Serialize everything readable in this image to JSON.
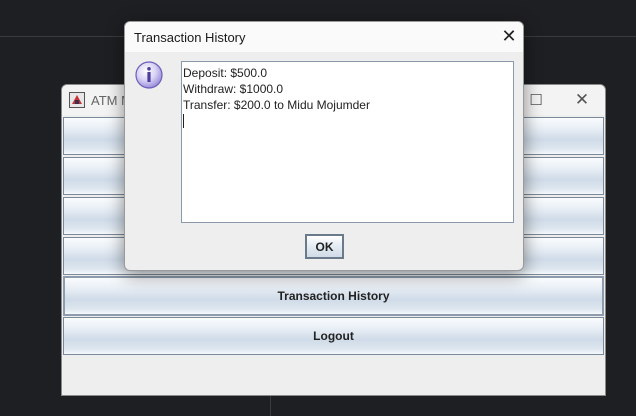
{
  "main_window": {
    "title": "ATM M",
    "buttons": [
      {
        "label": ""
      },
      {
        "label": ""
      },
      {
        "label": ""
      },
      {
        "label": ""
      },
      {
        "label": "Transaction History"
      },
      {
        "label": "Logout"
      }
    ]
  },
  "dialog": {
    "title": "Transaction History",
    "lines": [
      "Deposit: $500.0",
      "Withdraw: $1000.0",
      "Transfer: $200.0 to Midu Mojumder"
    ],
    "ok_label": "OK"
  },
  "icons": {
    "app": "atm-app-icon",
    "info": "info-icon",
    "close": "close-icon",
    "maximize": "maximize-icon"
  },
  "colors": {
    "desktop_bg": "#1e1f22",
    "info_icon": "#8c7fd0"
  }
}
